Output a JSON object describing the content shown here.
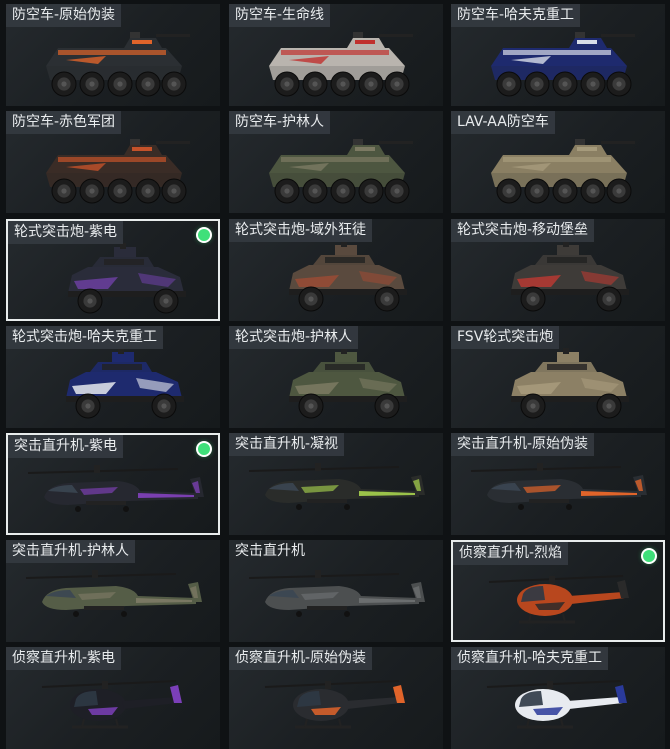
{
  "items": [
    {
      "name": "防空车-原始伪装",
      "type": "aa",
      "body": "#2b2f33",
      "accent": "#e0642a",
      "selected": false
    },
    {
      "name": "防空车-生命线",
      "type": "aa",
      "body": "#b9b4ae",
      "accent": "#c0312e",
      "selected": false
    },
    {
      "name": "防空车-哈夫克重工",
      "type": "aa",
      "body": "#1e2a6e",
      "accent": "#d8dde8",
      "selected": false
    },
    {
      "name": "防空车-赤色军团",
      "type": "aa",
      "body": "#3a2c26",
      "accent": "#c4522a",
      "selected": false
    },
    {
      "name": "防空车-护林人",
      "type": "aa",
      "body": "#4d5640",
      "accent": "#7c7a63",
      "selected": false
    },
    {
      "name": "LAV-AA防空车",
      "type": "aa",
      "body": "#8a7f63",
      "accent": "#a69b7c",
      "selected": false
    },
    {
      "name": "轮式突击炮-紫电",
      "type": "apc",
      "body": "#2a2c3a",
      "accent": "#6b3fa0",
      "selected": true
    },
    {
      "name": "轮式突击炮-域外狂徒",
      "type": "apc",
      "body": "#5a4a3e",
      "accent": "#9a4b35",
      "selected": false
    },
    {
      "name": "轮式突击炮-移动堡垒",
      "type": "apc",
      "body": "#3e3b38",
      "accent": "#b73a32",
      "selected": false
    },
    {
      "name": "轮式突击炮-哈夫克重工",
      "type": "apc",
      "body": "#1e2a6e",
      "accent": "#e6e9ee",
      "selected": false
    },
    {
      "name": "轮式突击炮-护林人",
      "type": "apc",
      "body": "#4e5740",
      "accent": "#7c7a63",
      "selected": false
    },
    {
      "name": "FSV轮式突击炮",
      "type": "apc",
      "body": "#8c8065",
      "accent": "#a89b7d",
      "selected": false
    },
    {
      "name": "突击直升机-紫电",
      "type": "heli",
      "body": "#262830",
      "accent": "#7a3fb0",
      "selected": true
    },
    {
      "name": "突击直升机-凝视",
      "type": "heli",
      "body": "#2a2c2a",
      "accent": "#9bc24a",
      "selected": false
    },
    {
      "name": "突击直升机-原始伪装",
      "type": "heli",
      "body": "#2a2e33",
      "accent": "#e0642a",
      "selected": false
    },
    {
      "name": "突击直升机-护林人",
      "type": "heli",
      "body": "#555d47",
      "accent": "#7a7863",
      "selected": false
    },
    {
      "name": "突击直升机",
      "type": "heli",
      "body": "#4c4f50",
      "accent": "#6b6e6f",
      "selected": false,
      "plain": true
    },
    {
      "name": "侦察直升机-烈焰",
      "type": "scout",
      "body": "#b8471e",
      "accent": "#2a2a2a",
      "selected": true
    },
    {
      "name": "侦察直升机-紫电",
      "type": "scout",
      "body": "#1e1f26",
      "accent": "#7b3fb8",
      "selected": false
    },
    {
      "name": "侦察直升机-原始伪装",
      "type": "scout",
      "body": "#2a2c30",
      "accent": "#e0642a",
      "selected": false
    },
    {
      "name": "侦察直升机-哈夫克重工",
      "type": "scout",
      "body": "#e8ebf0",
      "accent": "#2a3a9a",
      "selected": false
    }
  ]
}
